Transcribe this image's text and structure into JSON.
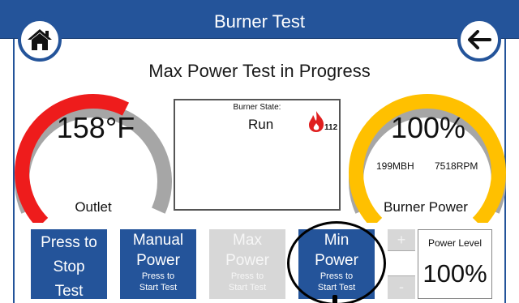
{
  "header": {
    "title": "Burner Test"
  },
  "nav": {
    "home_icon": "home-icon",
    "back_icon": "arrow-left-icon"
  },
  "subtitle": "Max Power Test in Progress",
  "outlet_gauge": {
    "value": "158°F",
    "label": "Outlet",
    "fill_fraction": 0.6,
    "fill_color": "#ee1c1c",
    "track_color": "#a6a6a6"
  },
  "burner_state": {
    "caption": "Burner State:",
    "value": "Run",
    "flame_icon": "flame-icon",
    "flame_color": "#e01f1f",
    "count": "112"
  },
  "power_gauge": {
    "value": "100%",
    "mbh": "199MBH",
    "rpm": "7518RPM",
    "label": "Burner Power",
    "fill_fraction": 1.0,
    "fill_color": "#ffc000"
  },
  "buttons": {
    "stop": {
      "label": "Press to Stop Test",
      "l1": "Press to",
      "l2": "Stop",
      "l3": "Test"
    },
    "manual": {
      "l1": "Manual",
      "l2": "Power",
      "sub1": "Press to",
      "sub2": "Start Test"
    },
    "max": {
      "l1": "Max",
      "l2": "Power",
      "sub1": "Press to",
      "sub2": "Start Test",
      "enabled": false
    },
    "min": {
      "l1": "Min",
      "l2": "Power",
      "sub1": "Press to",
      "sub2": "Start Test"
    }
  },
  "power_level": {
    "plus": "+",
    "minus": "-",
    "label": "Power Level",
    "value": "100%"
  },
  "colors": {
    "accent": "#24549a",
    "disabled": "#d7d7d7"
  }
}
